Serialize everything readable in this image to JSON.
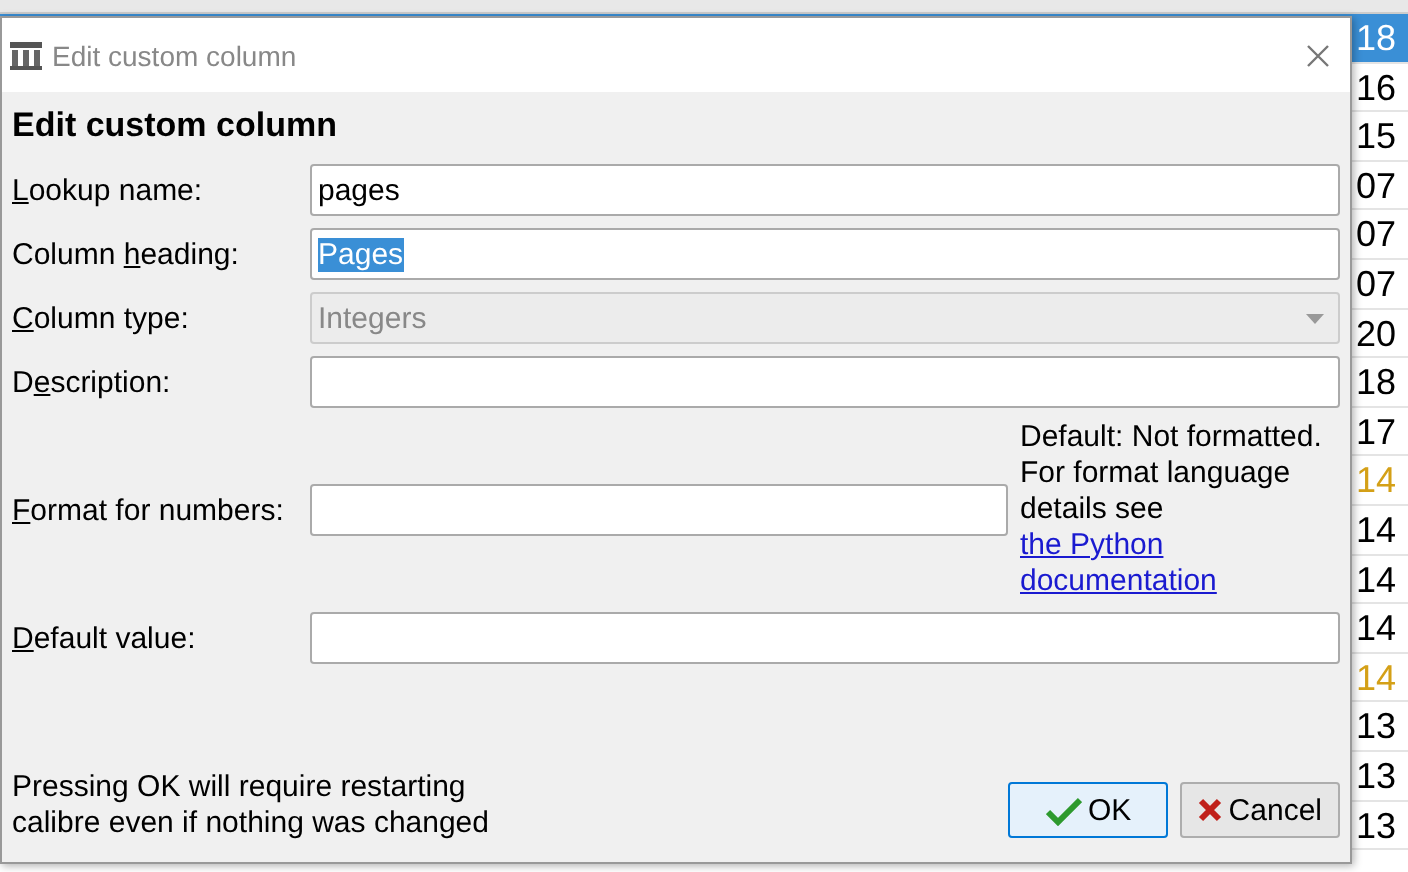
{
  "background_table": {
    "cells": [
      {
        "text": "18",
        "selected": true,
        "color": "#ffffff"
      },
      {
        "text": "16",
        "selected": false,
        "color": "#000000"
      },
      {
        "text": "15",
        "selected": false,
        "color": "#000000"
      },
      {
        "text": "07",
        "selected": false,
        "color": "#000000"
      },
      {
        "text": "07",
        "selected": false,
        "color": "#000000"
      },
      {
        "text": "07",
        "selected": false,
        "color": "#000000"
      },
      {
        "text": "20",
        "selected": false,
        "color": "#000000"
      },
      {
        "text": "18",
        "selected": false,
        "color": "#000000"
      },
      {
        "text": "17",
        "selected": false,
        "color": "#000000"
      },
      {
        "text": "14",
        "selected": false,
        "color": "#d4a017"
      },
      {
        "text": "14",
        "selected": false,
        "color": "#000000"
      },
      {
        "text": "14",
        "selected": false,
        "color": "#000000"
      },
      {
        "text": "14",
        "selected": false,
        "color": "#000000"
      },
      {
        "text": "14",
        "selected": false,
        "color": "#d4a017"
      },
      {
        "text": "13",
        "selected": false,
        "color": "#000000"
      },
      {
        "text": "13",
        "selected": false,
        "color": "#000000"
      },
      {
        "text": "13",
        "selected": false,
        "color": "#000000"
      }
    ]
  },
  "window": {
    "title": "Edit custom column"
  },
  "heading": "Edit custom column",
  "fields": [
    {
      "kind": "text",
      "label": {
        "key": "L",
        "post": "ookup name:"
      },
      "value": "pages"
    },
    {
      "kind": "text",
      "label": {
        "pre": "Column ",
        "key": "h",
        "post": "eading:"
      },
      "value": "Pages",
      "text_selected": true
    },
    {
      "kind": "combo",
      "label": {
        "key": "C",
        "post": "olumn type:"
      },
      "value": "Integers",
      "disabled": true
    },
    {
      "kind": "text",
      "label": {
        "pre": "D",
        "key": "e",
        "post": "scription:"
      }
    },
    {
      "kind": "help",
      "label": {
        "key": "F",
        "post": "ormat for numbers:"
      },
      "help": {
        "text": "Default: Not formatted. For format language details see",
        "link": "the Python documentation"
      }
    },
    {
      "kind": "text",
      "label": {
        "key": "D",
        "post": "efault value:"
      }
    }
  ],
  "note": "Pressing OK will require restarting calibre even if nothing was changed",
  "buttons": [
    {
      "kind": "ok",
      "label": "OK",
      "default": true
    },
    {
      "kind": "cancel",
      "label": "Cancel",
      "default": false
    }
  ]
}
